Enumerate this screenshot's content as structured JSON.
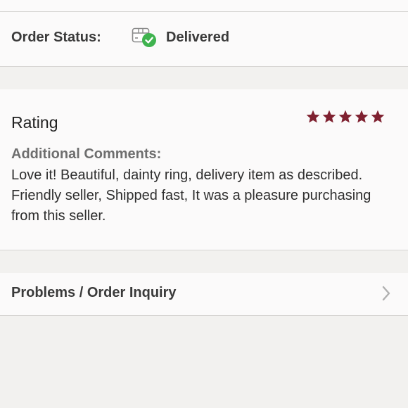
{
  "order_status": {
    "label": "Order Status:",
    "icon": "delivered-box-check-icon",
    "value": "Delivered"
  },
  "rating": {
    "title": "Rating",
    "stars_filled": 5,
    "stars_total": 5,
    "star_color": "#7f2130",
    "comments_label": "Additional Comments:",
    "comments_text": "Love it! Beautiful, dainty ring, delivery item as described. Friendly seller, Shipped fast, It was a pleasure purchasing from this seller."
  },
  "inquiry": {
    "label": "Problems / Order Inquiry",
    "icon": "chevron-right-icon"
  },
  "colors": {
    "check_green": "#3fb34f",
    "card_background": "#fbfafa",
    "page_background": "#f2f1ef"
  }
}
